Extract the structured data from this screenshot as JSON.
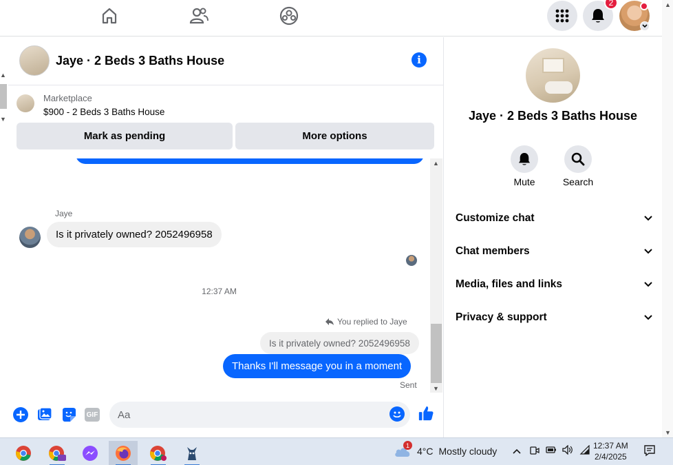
{
  "topnav": {
    "icons": [
      "home-icon",
      "friends-icon",
      "groups-icon"
    ],
    "notifications_count": "2"
  },
  "chat": {
    "title": "Jaye · 2 Beds 3 Baths House",
    "marketplace": {
      "label": "Marketplace",
      "listing": "$900 - 2 Beds 3 Baths House",
      "mark_pending": "Mark as pending",
      "more_options": "More options"
    },
    "messages": {
      "sender_name": "Jaye",
      "incoming_text": "Is it privately owned? 2052496958",
      "timestamp": "12:37 AM",
      "replied_to": "You replied to Jaye",
      "quoted_text": "Is it privately owned? 2052496958",
      "outgoing_text": "Thanks I'll message you in a moment",
      "status": "Sent"
    },
    "composer": {
      "placeholder": "Aa",
      "gif_label": "GIF"
    }
  },
  "details": {
    "title": "Jaye · 2 Beds 3 Baths House",
    "actions": [
      {
        "label": "Mute",
        "icon": "bell-icon"
      },
      {
        "label": "Search",
        "icon": "search-icon"
      }
    ],
    "sections": [
      "Customize chat",
      "Chat members",
      "Media, files and links",
      "Privacy & support"
    ]
  },
  "taskbar": {
    "weather_alert": "1",
    "temperature": "4°C",
    "weather_text": "Mostly cloudy",
    "time": "12:37 AM",
    "date": "2/4/2025"
  },
  "colors": {
    "accent": "#0866ff",
    "bubble_in": "#f0f0f0",
    "button_gray": "#e4e6eb",
    "badge_red": "#e41e3f"
  }
}
